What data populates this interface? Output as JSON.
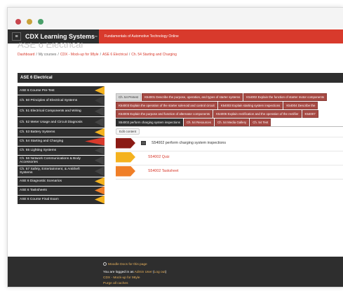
{
  "window": {
    "controls": [
      "close",
      "minimize",
      "maximize"
    ]
  },
  "header": {
    "menu_icon": "hamburger-icon",
    "brand": "CDX Learning Systems",
    "brand_mark": "™",
    "course_title": "Fundamentals of Automotive Technology Online"
  },
  "page": {
    "ghost_title": "ASE 6 Electrical"
  },
  "breadcrumb": {
    "items": [
      "Dashboard",
      "My courses",
      "CDX - Mock-up for 98yle",
      "ASE 6 Electrical",
      "Ch. 54 Starting and Charging"
    ],
    "separator": "/"
  },
  "section": {
    "title": "ASE 6 Electrical"
  },
  "sidebar": {
    "items": [
      {
        "label": "ASE 6 Course Pre-Test"
      },
      {
        "label": "Ch. 50 Principles of Electrical Systems"
      },
      {
        "label": "Ch. 51 Electrical Components and Wiring"
      },
      {
        "label": "Ch. 52 Meter Usage and Circuit Diagnosis"
      },
      {
        "label": "Ch. 53 Battery Systems"
      },
      {
        "label": "Ch. 54 Starting and Charging"
      },
      {
        "label": "Ch. 55 Lighting Systems"
      },
      {
        "label": "Ch. 56 Network Communications & Body Accessories"
      },
      {
        "label": "Ch. 57 Safety, Entertainment, & Antitheft Systems"
      },
      {
        "label": "ASE 6 Diagnostic Scenarios"
      },
      {
        "label": "ASE 6 Tasksheets"
      },
      {
        "label": "ASE 6 Course Final Exam"
      }
    ],
    "active_index": 5
  },
  "tabs": {
    "rows": [
      [
        "Ch. 54 Pretest",
        "K54001 Describe the purpose, operation, and types of starter systems",
        "K54002 Explain the function of starter motor components"
      ],
      [
        "K54003 Explain the operation of the starter solenoid and control circuit",
        "K54003 Explain starting system inspections",
        "K54004 Describe the"
      ],
      [
        "K54005 Explain the purpose and function of alternator components",
        "K54006 Explain rectification and the operation of the rectifier",
        "K54007"
      ],
      [
        "S54002 perform charging system inspections",
        "Ch. 54 Resources",
        "Ch. 54 Media Gallery",
        "Ch. 54 Test"
      ]
    ]
  },
  "content": {
    "edit_button": "Edit content",
    "activities": [
      {
        "label": "S54002 perform charging system inspections",
        "color": "#8b1a14",
        "icon": "file-icon"
      },
      {
        "label": "S54002 Quiz",
        "color": "#f4b21f"
      },
      {
        "label": "S54002 Tasksheet",
        "color": "#f07f28"
      }
    ]
  },
  "footer": {
    "docs_link": "Moodle Docs for this page",
    "logged_in_prefix": "You are logged in as",
    "user_name": "Admin User",
    "logout": "Log out",
    "course_link": "CDX - Mock-up for 98yle",
    "purge_link": "Purge all caches"
  },
  "colors": {
    "brand_red": "#d83a2c",
    "dark": "#2e2e2e",
    "tab_red": "#a64943",
    "sidebar_arrow_active": "#f4b21f",
    "sidebar_arrow_alt": "#f07f28"
  }
}
